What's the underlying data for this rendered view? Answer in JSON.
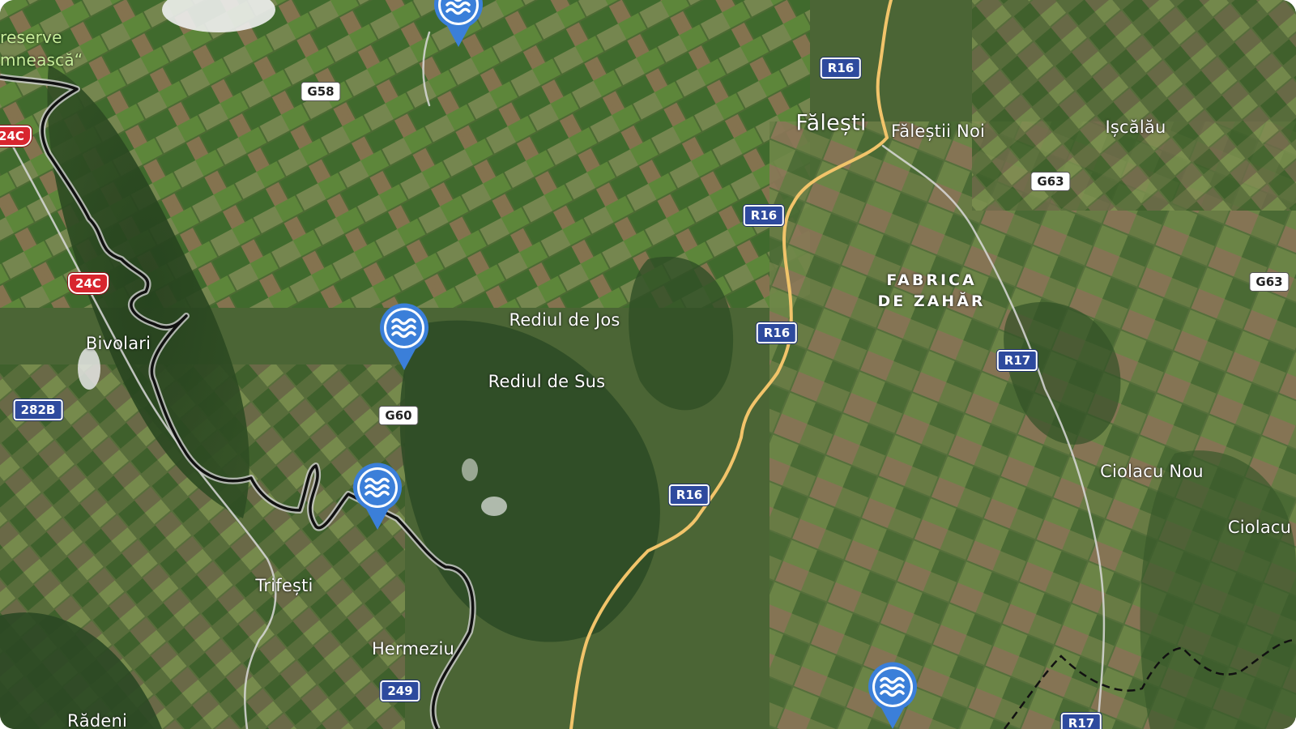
{
  "map": {
    "view": "satellite",
    "colors": {
      "major_road": "#f2c46a",
      "minor_road": "#d9d9d9",
      "border": "#111111",
      "border_outline": "#cfcfcf",
      "poi_marker": "#3b7fd9",
      "national_shield": "#2e4a9e",
      "euro_route_shield": "#d8262f"
    },
    "labels": {
      "falesti": "Fălești",
      "falestii_noi": "Făleștii Noi",
      "iscalau": "Ișcălău",
      "fabrica": "FABRICA\nDE ZAHĂR",
      "rediul_jos": "Rediul de Jos",
      "rediul_sus": "Rediul de Sus",
      "bivolari": "Bivolari",
      "trifesti": "Trifești",
      "hermeziu": "Hermeziu",
      "ciolacu_nou": "Ciolacu Nou",
      "ciolacu": "Ciolacu",
      "radeni": "Rădeni",
      "reserve_line1": "reserve",
      "reserve_line2": "mnească“"
    },
    "shields": {
      "r16_a": "R16",
      "r16_b": "R16",
      "r16_c": "R16",
      "r16_d": "R16",
      "r17_a": "R17",
      "r17_b": "R17",
      "g58": "G58",
      "g60": "G60",
      "g63_a": "G63",
      "g63_b": "G63",
      "e24c_a": "24C",
      "e24c_b": "24C",
      "n282b": "282B",
      "n249": "249"
    },
    "poi_markers": [
      {
        "icon": "water-waves-icon"
      },
      {
        "icon": "water-waves-icon"
      },
      {
        "icon": "water-waves-icon"
      },
      {
        "icon": "water-waves-icon"
      }
    ]
  }
}
